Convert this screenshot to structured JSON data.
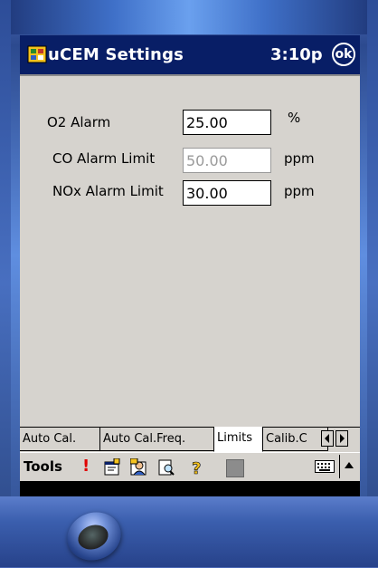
{
  "titlebar": {
    "title": "uCEM Settings",
    "time": "3:10p",
    "ok_label": "ok"
  },
  "form": {
    "o2": {
      "label": "O2 Alarm",
      "value": "25.00",
      "unit": "%"
    },
    "co": {
      "label": "CO Alarm Limit",
      "value": "50.00",
      "unit": "ppm",
      "disabled": true
    },
    "nox": {
      "label": "NOx Alarm Limit",
      "value": "30.00",
      "unit": "ppm"
    }
  },
  "tabs": [
    {
      "label": "Auto Cal."
    },
    {
      "label": "Auto Cal.Freq."
    },
    {
      "label": "Limits",
      "active": true
    },
    {
      "label": "Calib.C"
    }
  ],
  "cmdbar": {
    "tools_label": "Tools",
    "icons": [
      "alert-icon",
      "properties-icon",
      "user-icon",
      "find-icon",
      "help-icon",
      "square-icon",
      "keyboard-icon",
      "sip-up-arrow-icon"
    ]
  },
  "colors": {
    "titlebar": "#081e66",
    "screen": "#d6d3ce",
    "alert": "#e00000"
  }
}
